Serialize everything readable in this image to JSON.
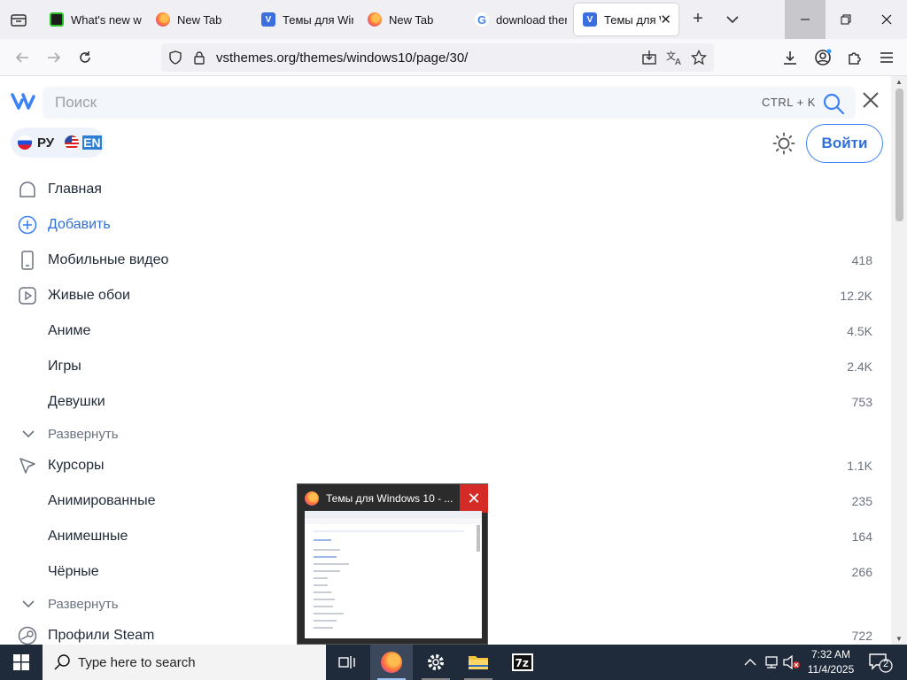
{
  "browser": {
    "tabs": [
      {
        "label": "What's new w",
        "favicon": "green-terminal-icon"
      },
      {
        "label": "New Tab",
        "favicon": "firefox-icon"
      },
      {
        "label": "Темы для Win",
        "favicon": "vsthemes-icon"
      },
      {
        "label": "New Tab",
        "favicon": "firefox-icon"
      },
      {
        "label": "download ther",
        "favicon": "google-icon"
      },
      {
        "label": "Темы для W",
        "favicon": "vsthemes-icon",
        "active": true
      }
    ],
    "url": "vsthemes.org/themes/windows10/page/30/"
  },
  "page": {
    "search_placeholder": "Поиск",
    "search_shortcut": "CTRL + K",
    "lang_ru": "РУ",
    "lang_en": "EN",
    "login_label": "Войти",
    "accent_color": "#2f6fd8",
    "menu": [
      {
        "label": "Главная",
        "icon": "home-icon",
        "count": ""
      },
      {
        "label": "Добавить",
        "icon": "plus-circle-icon",
        "count": ""
      },
      {
        "label": "Мобильные видео",
        "icon": "phone-icon",
        "count": "418"
      },
      {
        "label": "Живые обои",
        "icon": "video-icon",
        "count": "12.2K"
      },
      {
        "label": "Аниме",
        "icon": "",
        "count": "4.5K"
      },
      {
        "label": "Игры",
        "icon": "",
        "count": "2.4K"
      },
      {
        "label": "Девушки",
        "icon": "",
        "count": "753"
      },
      {
        "label": "Развернуть",
        "icon": "chevron-down-icon",
        "count": ""
      },
      {
        "label": "Курсоры",
        "icon": "cursor-icon",
        "count": "1.1K"
      },
      {
        "label": "Анимированные",
        "icon": "",
        "count": "235"
      },
      {
        "label": "Анимешные",
        "icon": "",
        "count": "164"
      },
      {
        "label": "Чёрные",
        "icon": "",
        "count": "266"
      },
      {
        "label": "Развернуть",
        "icon": "chevron-down-icon",
        "count": ""
      },
      {
        "label": "Профили Steam",
        "icon": "steam-icon",
        "count": "722"
      }
    ]
  },
  "thumbnail": {
    "title": "Темы для Windows 10 - ..."
  },
  "taskbar": {
    "search_label": "Type here to search",
    "time": "7:32 AM",
    "date": "11/4/2025",
    "notifications": "2"
  }
}
